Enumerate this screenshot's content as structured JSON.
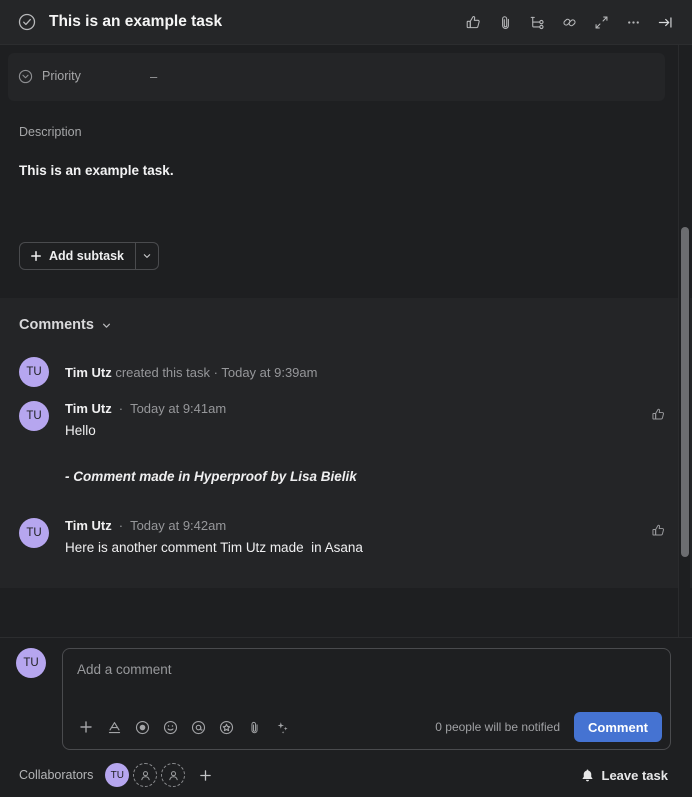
{
  "header": {
    "title": "This is an example task",
    "complete_icon": "check-circle-icon",
    "actions": [
      {
        "name": "like-button",
        "icon": "thumbs-up-icon"
      },
      {
        "name": "attach-button",
        "icon": "paperclip-icon"
      },
      {
        "name": "subtask-button",
        "icon": "subtask-branch-icon"
      },
      {
        "name": "copy-link-button",
        "icon": "link-icon"
      },
      {
        "name": "fullscreen-button",
        "icon": "expand-arrows-icon"
      },
      {
        "name": "more-options-button",
        "icon": "ellipsis-icon"
      },
      {
        "name": "close-panel-button",
        "icon": "arrow-right-bar-icon"
      }
    ]
  },
  "fields": {
    "priority": {
      "label": "Priority",
      "value": "–",
      "icon": "chevron-down-circle-icon"
    }
  },
  "description": {
    "label": "Description",
    "text": "This is an example task."
  },
  "subtask": {
    "label": "Add subtask",
    "plus_icon": "plus-icon",
    "caret_icon": "chevron-down-icon"
  },
  "comments": {
    "heading": "Comments",
    "heading_caret": "chevron-down-icon",
    "activity": {
      "avatar": "TU",
      "author": "Tim Utz",
      "action": "created this task",
      "separator": "·",
      "timestamp": "Today at 9:39am"
    },
    "items": [
      {
        "avatar": "TU",
        "author": "Tim Utz",
        "separator": "·",
        "timestamp": "Today at 9:41am",
        "body": "Hello",
        "extra_body": "- Comment made in Hyperproof by Lisa Bielik",
        "extra_italic": true,
        "like_icon": "thumbs-up-icon"
      },
      {
        "avatar": "TU",
        "author": "Tim Utz",
        "separator": "·",
        "timestamp": "Today at 9:42am",
        "body": "Here is another comment Tim Utz made  in Asana",
        "extra_body": "",
        "extra_italic": false,
        "like_icon": "thumbs-up-icon"
      }
    ]
  },
  "composer": {
    "avatar": "TU",
    "placeholder": "Add a comment",
    "tools": [
      {
        "name": "add-attachment-tool",
        "icon": "plus-icon"
      },
      {
        "name": "text-format-tool",
        "icon": "text-format-icon"
      },
      {
        "name": "record-tool",
        "icon": "record-circle-icon"
      },
      {
        "name": "emoji-tool",
        "icon": "smiley-icon"
      },
      {
        "name": "mention-tool",
        "icon": "at-sign-icon"
      },
      {
        "name": "sticker-tool",
        "icon": "star-circle-icon"
      },
      {
        "name": "attach-file-tool",
        "icon": "paperclip-icon"
      },
      {
        "name": "ai-assist-tool",
        "icon": "sparkles-icon"
      }
    ],
    "notified_text": "0 people will be notified",
    "submit_label": "Comment"
  },
  "footer": {
    "collaborators_label": "Collaborators",
    "collaborators": [
      "TU"
    ],
    "ghost_slots": 2,
    "add_label": "+",
    "leave_task_label": "Leave task",
    "leave_task_icon": "bell-icon"
  },
  "colors": {
    "accent": "#4573d2",
    "avatar": "#b6a6ef",
    "panel": "#242527",
    "background": "#1e1f21"
  }
}
